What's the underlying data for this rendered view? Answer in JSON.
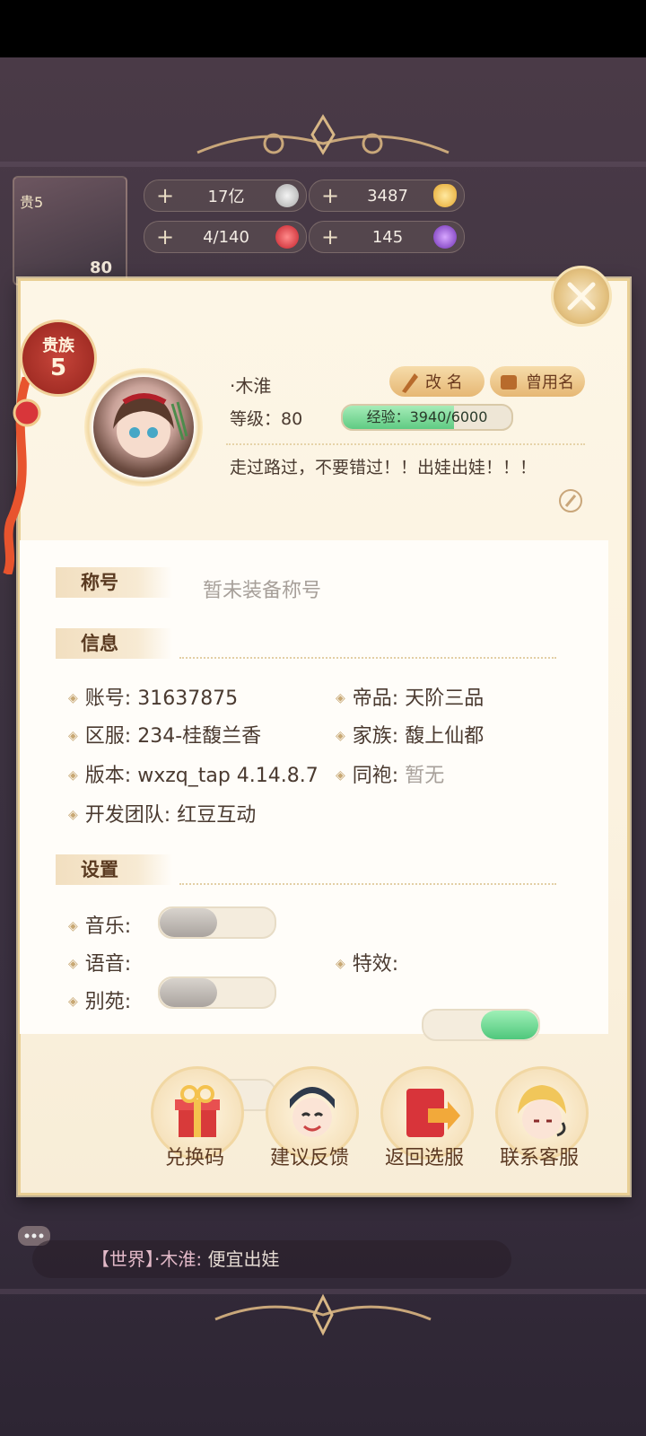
{
  "top_bar": {
    "noble_small": "贵5",
    "level": "80",
    "resources": [
      {
        "value": "17亿",
        "icon": "silver-coin-icon"
      },
      {
        "value": "3487",
        "icon": "gold-ingot-icon"
      },
      {
        "value": "4/140",
        "icon": "heart-icon"
      },
      {
        "value": "145",
        "icon": "purple-gem-icon"
      }
    ]
  },
  "profile": {
    "noble_label": "贵族",
    "noble_level": "5",
    "nickname": "·木淮",
    "rename_label": "改 名",
    "former_names_label": "曾用名",
    "level_label": "等级：80",
    "exp_label": "经验：3940/6000",
    "exp_fraction": 0.657,
    "signature": "走过路过，不要错过！！出娃出娃！！！"
  },
  "sections": {
    "title_tab": "称号",
    "title_value": "暂未装备称号",
    "info_tab": "信息",
    "settings_tab": "设置"
  },
  "info": [
    {
      "label": "账号:",
      "value": "31637875"
    },
    {
      "label": "帝品:",
      "value": "天阶三品"
    },
    {
      "label": "区服:",
      "value": "234-桂馥兰香"
    },
    {
      "label": "家族:",
      "value": "馥上仙都"
    },
    {
      "label": "版本:",
      "value": "wxzq_tap 4.14.8.7"
    },
    {
      "label": "同袍:",
      "value": "暂无"
    },
    {
      "label": "开发团队:",
      "value": "红豆互动"
    }
  ],
  "settings": [
    {
      "label": "音乐:",
      "on": false
    },
    {
      "label": "语音:",
      "on": false
    },
    {
      "label": "特效:",
      "on": true
    },
    {
      "label": "别苑:",
      "on": false
    }
  ],
  "actions": [
    {
      "label": "兑换码",
      "icon": "gift-box-icon"
    },
    {
      "label": "建议反馈",
      "icon": "character-avatar-icon"
    },
    {
      "label": "返回选服",
      "icon": "red-book-return-icon"
    },
    {
      "label": "联系客服",
      "icon": "support-character-icon"
    }
  ],
  "chat": {
    "channel": "【世界】",
    "sender": "·木淮:",
    "message": "便宜出娃"
  },
  "colors": {
    "panel_bg": "#fdf6e6",
    "accent_gold": "#e6b774",
    "noble_red": "#9e2a22",
    "toggle_on": "#4fc77c",
    "text_brown": "#4a3a30"
  }
}
